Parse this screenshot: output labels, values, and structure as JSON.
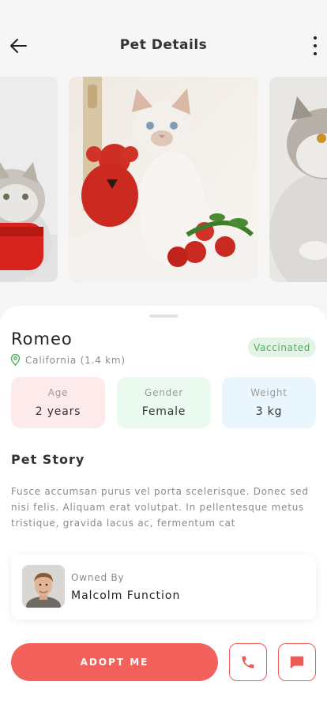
{
  "header": {
    "title": "Pet Details",
    "back_icon": "arrow-left-icon",
    "menu_icon": "more-vertical-icon"
  },
  "gallery": {
    "photos": [
      "cat-photo-left",
      "cat-photo-main",
      "cat-photo-right"
    ]
  },
  "pet": {
    "name": "Romeo",
    "location": "California (1.4 km)",
    "badge": "Vaccinated",
    "stats": [
      {
        "label": "Age",
        "value": "2 years",
        "color": "#fcebea"
      },
      {
        "label": "Gender",
        "value": "Female",
        "color": "#ebfaee"
      },
      {
        "label": "Weight",
        "value": "3 kg",
        "color": "#eaf6fd"
      }
    ]
  },
  "story": {
    "title": "Pet Story",
    "text": "Fusce accumsan purus vel porta scelerisque. Donec sed nisi felis. Aliquam erat volutpat. In pellentesque metus tristique, gravida lacus ac, fermentum cat"
  },
  "owner": {
    "label": "Owned By",
    "name": "Malcolm Function"
  },
  "actions": {
    "adopt_label": "ADOPT ME",
    "call_icon": "phone-icon",
    "chat_icon": "chat-icon"
  },
  "colors": {
    "accent": "#f2615b",
    "badge_green": "#4cae5e"
  }
}
